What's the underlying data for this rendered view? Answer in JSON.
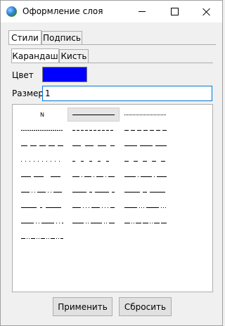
{
  "window": {
    "title": "Оформление слоя"
  },
  "tabs": [
    {
      "label": "Стили",
      "active": true
    },
    {
      "label": "Подпись",
      "active": false
    }
  ],
  "subtabs": [
    {
      "label": "Карандаш",
      "active": true
    },
    {
      "label": "Кисть",
      "active": false
    }
  ],
  "form": {
    "color_label": "Цвет",
    "color_value": "#0000ff",
    "size_label": "Размер",
    "size_value": "1"
  },
  "line_styles": {
    "none_label": "N",
    "selected": "solid",
    "items": [
      "none",
      "solid",
      "dot",
      "dense-dot",
      "short-dash",
      "medium-dash",
      "long-dash",
      "dash-gap",
      "dash-short",
      "sparse-dot",
      "spaced-dash",
      "dash-spaced",
      "dash-dash-gap",
      "dash-dot",
      "long-dash-dot",
      "dash-dot-dot",
      "long-dash-short",
      "long-dash-dash-short",
      "long-dash-small",
      "dash-dot-dot-dot",
      "long-dash-dot-dot-dot",
      "long-dash-dot-dot",
      "dash-dot-dash",
      "dash-dot-dot-long",
      "dash-dot-long"
    ]
  },
  "buttons": {
    "apply_label": "Применить",
    "reset_label": "Сбросить"
  }
}
